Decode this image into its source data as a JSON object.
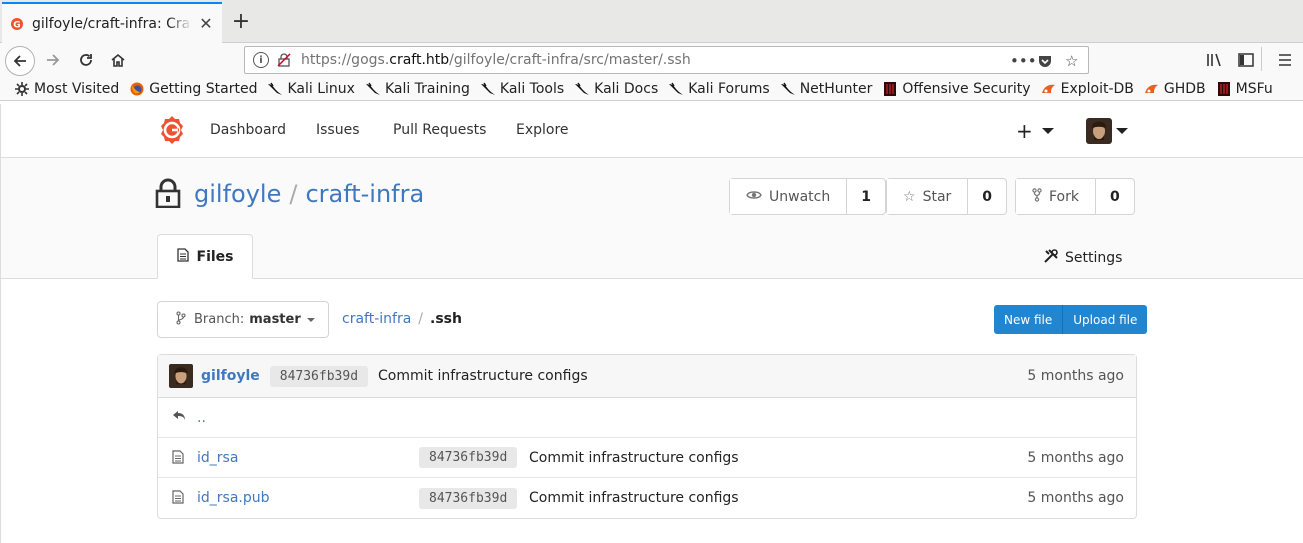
{
  "browser": {
    "tab_title": "gilfoyle/craft-infra: Craft",
    "url_prefix": "https://gogs.",
    "url_domain": "craft.htb",
    "url_path": "/gilfoyle/craft-infra/src/master/.ssh",
    "bookmarks": [
      {
        "label": "Most Visited",
        "icon": "gear-icon"
      },
      {
        "label": "Getting Started",
        "icon": "firefox-icon"
      },
      {
        "label": "Kali Linux",
        "icon": "kali-dragon-icon"
      },
      {
        "label": "Kali Training",
        "icon": "kali-dragon-icon"
      },
      {
        "label": "Kali Tools",
        "icon": "kali-dragon-icon"
      },
      {
        "label": "Kali Docs",
        "icon": "kali-dragon-icon"
      },
      {
        "label": "Kali Forums",
        "icon": "kali-dragon-icon"
      },
      {
        "label": "NetHunter",
        "icon": "kali-dragon-icon"
      },
      {
        "label": "Offensive Security",
        "icon": "offsec-icon"
      },
      {
        "label": "Exploit-DB",
        "icon": "exploitdb-icon"
      },
      {
        "label": "GHDB",
        "icon": "exploitdb-icon"
      },
      {
        "label": "MSFu",
        "icon": "offsec-icon"
      }
    ]
  },
  "topnav": {
    "items": [
      "Dashboard",
      "Issues",
      "Pull Requests",
      "Explore"
    ]
  },
  "repo": {
    "owner": "gilfoyle",
    "name": "craft-infra",
    "watch_label": "Unwatch",
    "watch_count": "1",
    "star_label": "Star",
    "star_count": "0",
    "fork_label": "Fork",
    "fork_count": "0",
    "tab_files": "Files",
    "tab_settings": "Settings"
  },
  "browser_bar": {
    "branch_label": "Branch:",
    "branch_name": "master",
    "crumb_root": "craft-infra",
    "crumb_current": ".ssh",
    "new_file": "New file",
    "upload_file": "Upload file"
  },
  "latest_commit": {
    "user": "gilfoyle",
    "sha": "84736fb39d",
    "message": "Commit infrastructure configs",
    "age": "5 months ago"
  },
  "parent_link": "..",
  "files": [
    {
      "name": "id_rsa",
      "sha": "84736fb39d",
      "message": "Commit infrastructure configs",
      "age": "5 months ago"
    },
    {
      "name": "id_rsa.pub",
      "sha": "84736fb39d",
      "message": "Commit infrastructure configs",
      "age": "5 months ago"
    }
  ],
  "colors": {
    "link": "#4078c0",
    "primary_button": "#2185d0",
    "gogs_logo": "#f05133"
  }
}
